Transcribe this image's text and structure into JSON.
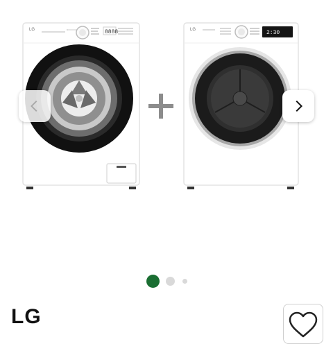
{
  "product": {
    "brand": "LG",
    "images": [
      {
        "name": "washing-machine",
        "logo": "LG",
        "display": "8888"
      },
      {
        "name": "dryer",
        "logo": "LG",
        "display": "2:30"
      }
    ]
  },
  "carousel": {
    "active_index": 0,
    "total_dots": 3,
    "active_color": "#1a6e32",
    "inactive_color": "#d9d9d9"
  },
  "icons": {
    "prev": "chevron-left-icon",
    "next": "chevron-right-icon",
    "plus": "plus-icon",
    "favorite": "heart-icon"
  }
}
